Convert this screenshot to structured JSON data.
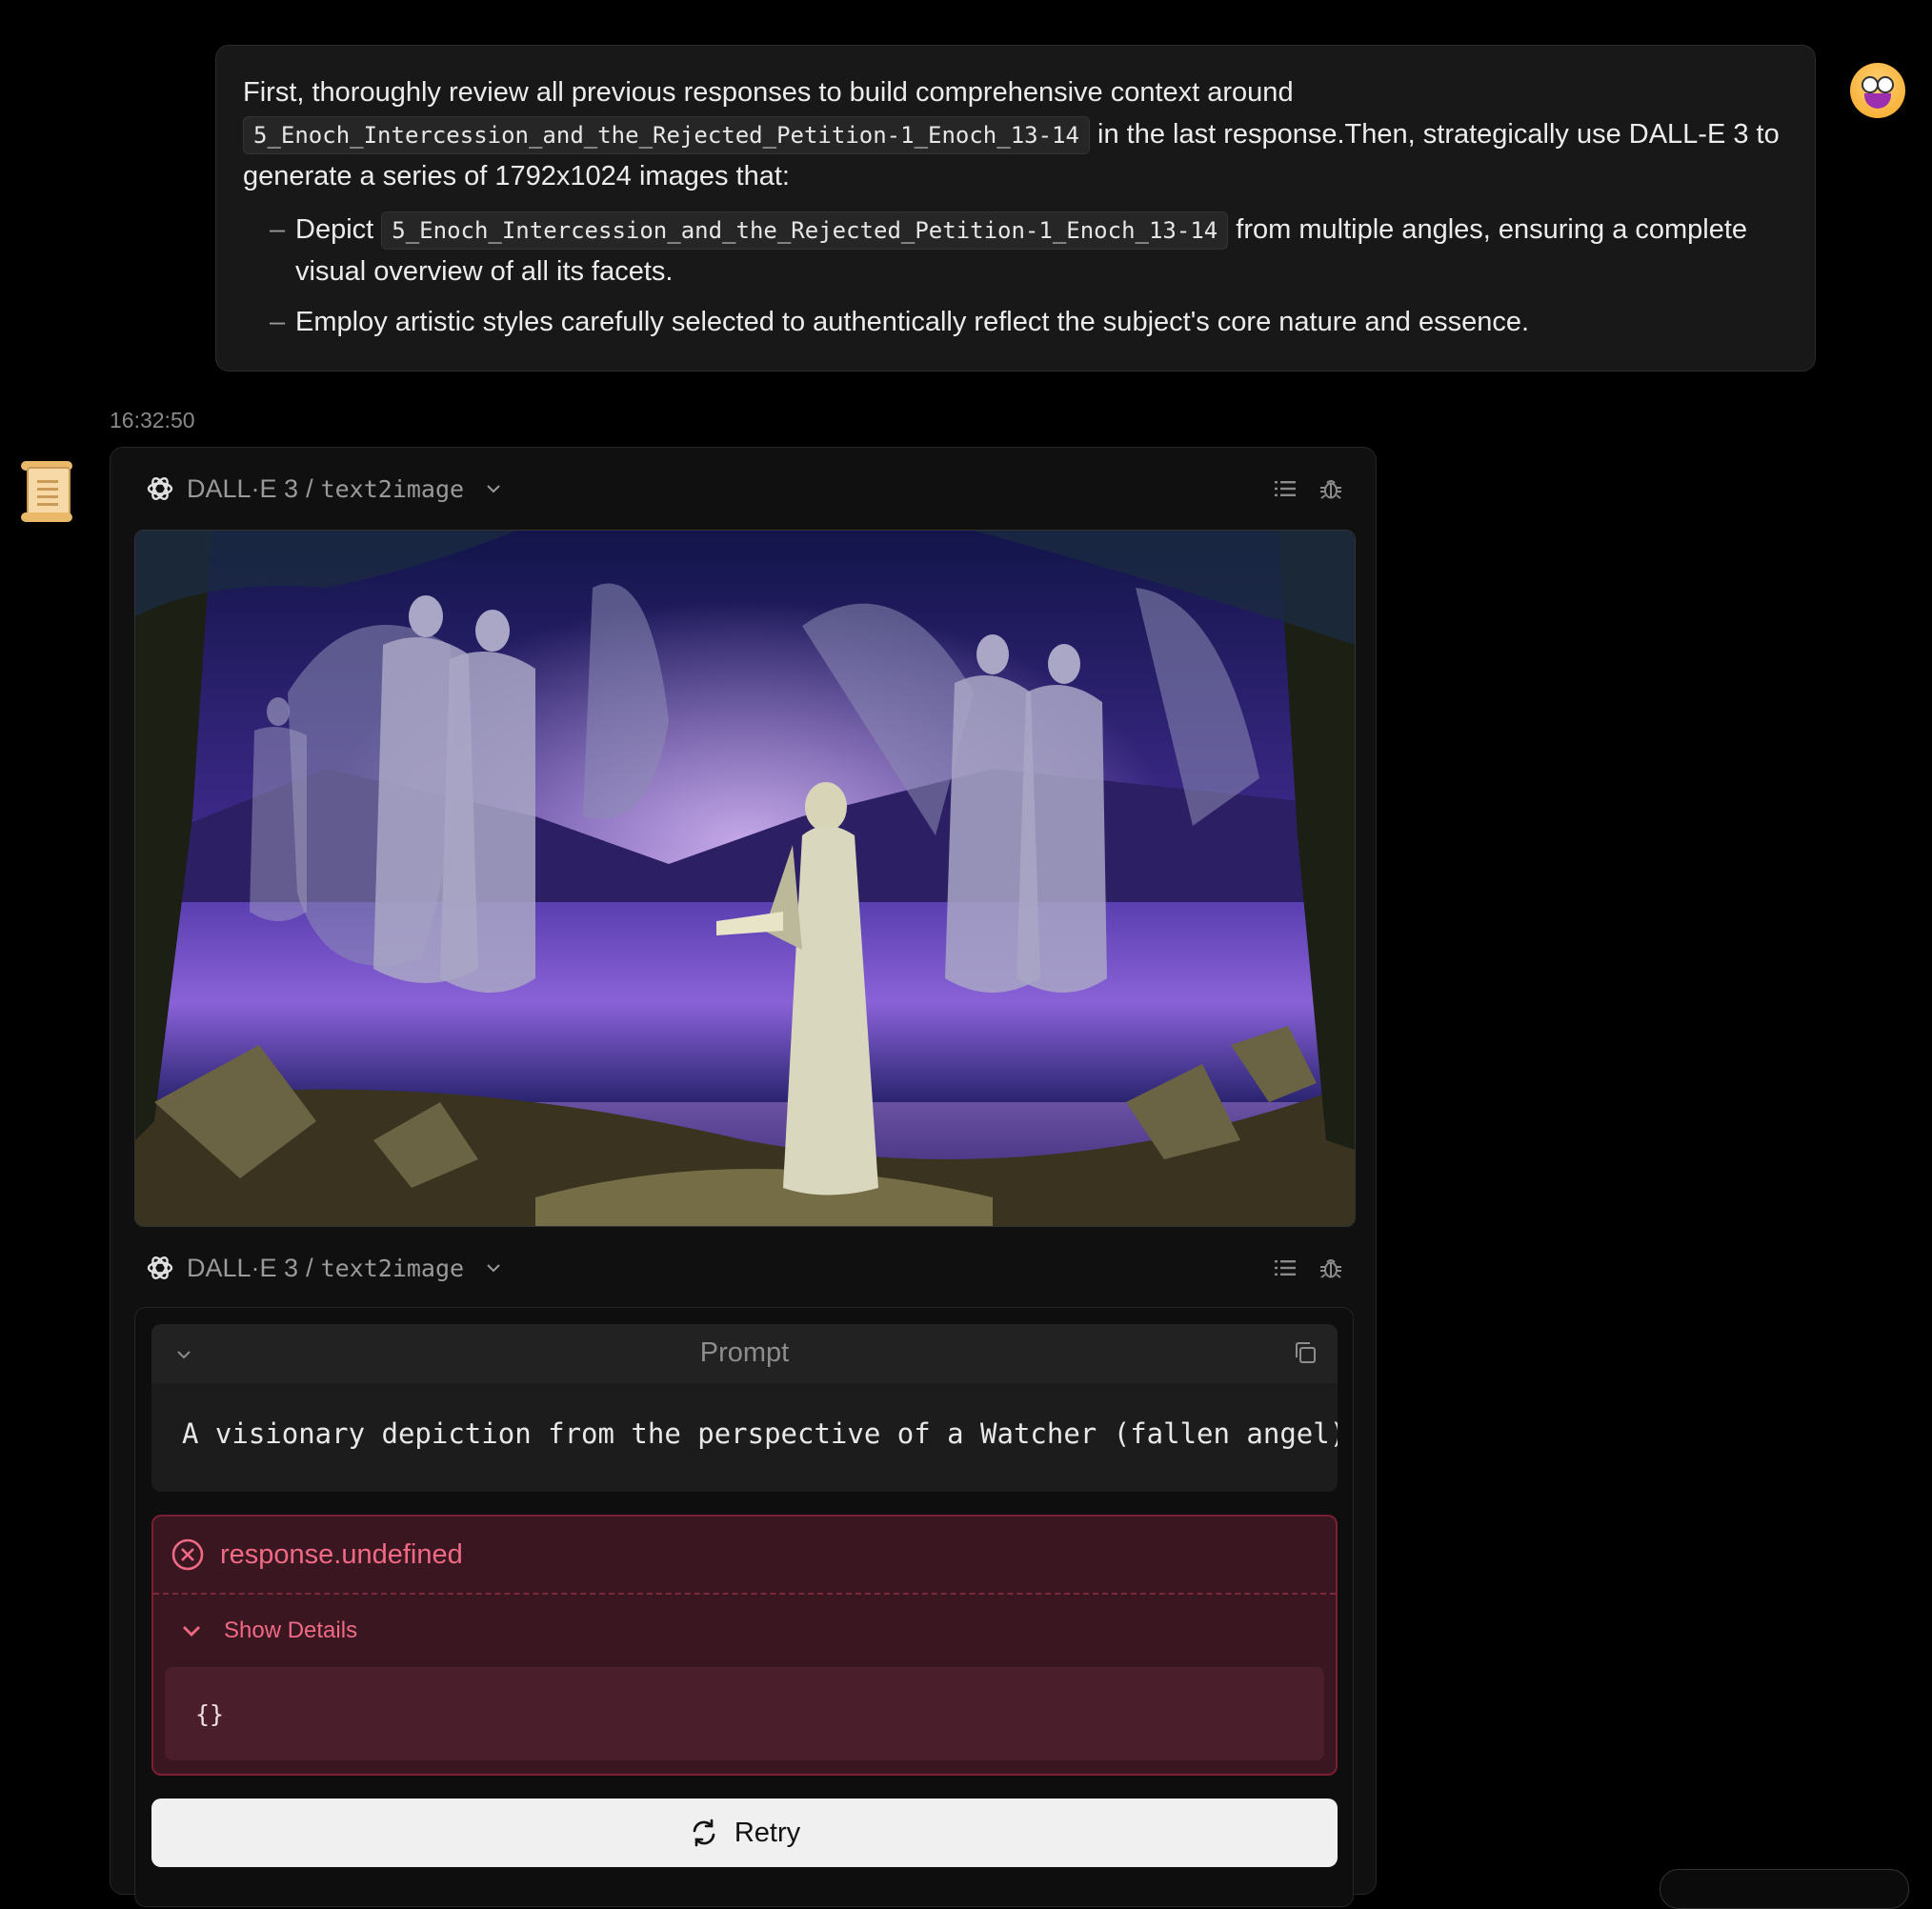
{
  "user_message": {
    "intro_before": "First, thoroughly review all previous responses to build comprehensive context around",
    "subject_code": "5_Enoch_Intercession_and_the_Rejected_Petition-1_Enoch_13-14",
    "intro_after": "in the last response.Then, strategically use DALL-E 3 to generate a series of 1792x1024 images that:",
    "bullet_dash": "–",
    "bullet1_before": "Depict",
    "bullet1_code": "5_Enoch_Intercession_and_the_Rejected_Petition-1_Enoch_13-14",
    "bullet1_after": "from multiple angles, ensuring a complete visual overview of all its facets.",
    "bullet2": "Employ artistic styles carefully selected to authentically reflect the subject's core nature and essence."
  },
  "timestamp": "16:32:50",
  "tool_calls": [
    {
      "plugin": "DALL·E 3",
      "separator": "/",
      "api": "text2image"
    },
    {
      "plugin": "DALL·E 3",
      "separator": "/",
      "api": "text2image"
    }
  ],
  "prompt": {
    "title": "Prompt",
    "text": "A visionary depiction from the perspective of a Watcher (fallen angel),"
  },
  "error": {
    "message": "response.undefined",
    "details_label": "Show Details",
    "details_body": "{}"
  },
  "retry_label": "Retry",
  "colors": {
    "error_text": "#f06a85",
    "error_bg": "#3a1620",
    "error_border": "#7a1f34",
    "retry_bg": "#f0f0f0"
  }
}
